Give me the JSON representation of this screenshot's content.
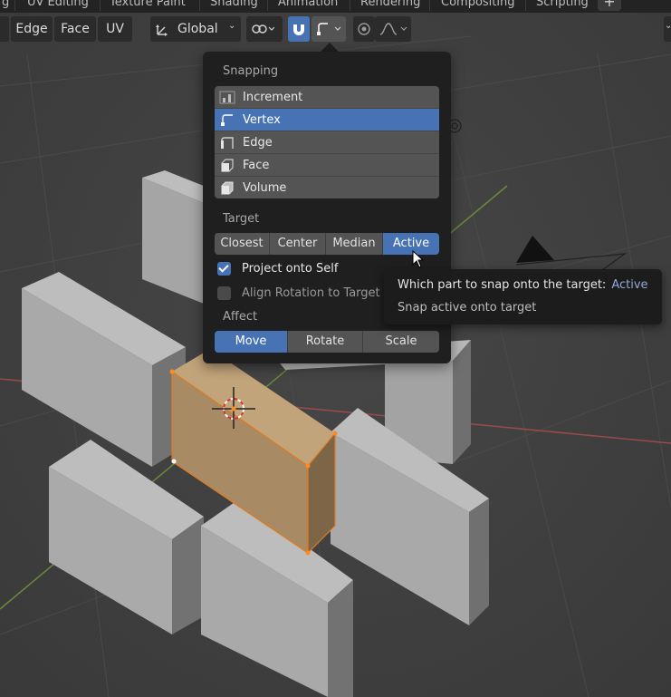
{
  "workspace_tabs": [
    "g",
    "UV Editing",
    "Texture Paint",
    "Shading",
    "Animation",
    "Rendering",
    "Compositing",
    "Scripting"
  ],
  "workspace_add": "+",
  "toolbar": {
    "select_edge": "Edge",
    "select_face": "Face",
    "uv_menu": "UV",
    "orientation": "Global",
    "orientation_caret": "⌄"
  },
  "snap_panel": {
    "snapping_title": "Snapping",
    "snap_elements": [
      {
        "label": "Increment",
        "icon": "increment-icon",
        "selected": false
      },
      {
        "label": "Vertex",
        "icon": "vertex-icon",
        "selected": true
      },
      {
        "label": "Edge",
        "icon": "edge-icon",
        "selected": false
      },
      {
        "label": "Face",
        "icon": "face-icon",
        "selected": false
      },
      {
        "label": "Volume",
        "icon": "volume-icon",
        "selected": false
      }
    ],
    "target_title": "Target",
    "target_options": [
      "Closest",
      "Center",
      "Median",
      "Active"
    ],
    "target_active": "Active",
    "project_onto_self": {
      "label": "Project onto Self",
      "checked": true
    },
    "align_rotation": {
      "label": "Align Rotation to Target",
      "checked": false
    },
    "affect_title": "Affect",
    "affect_options": [
      "Move",
      "Rotate",
      "Scale"
    ],
    "affect_active": "Move"
  },
  "tooltip": {
    "description": "Which part to snap onto the target:",
    "value": "Active",
    "python": "Snap active onto target"
  },
  "colors": {
    "accent": "#4772b3",
    "selected_face": "#a88b64",
    "background": "#3d3d3d"
  }
}
